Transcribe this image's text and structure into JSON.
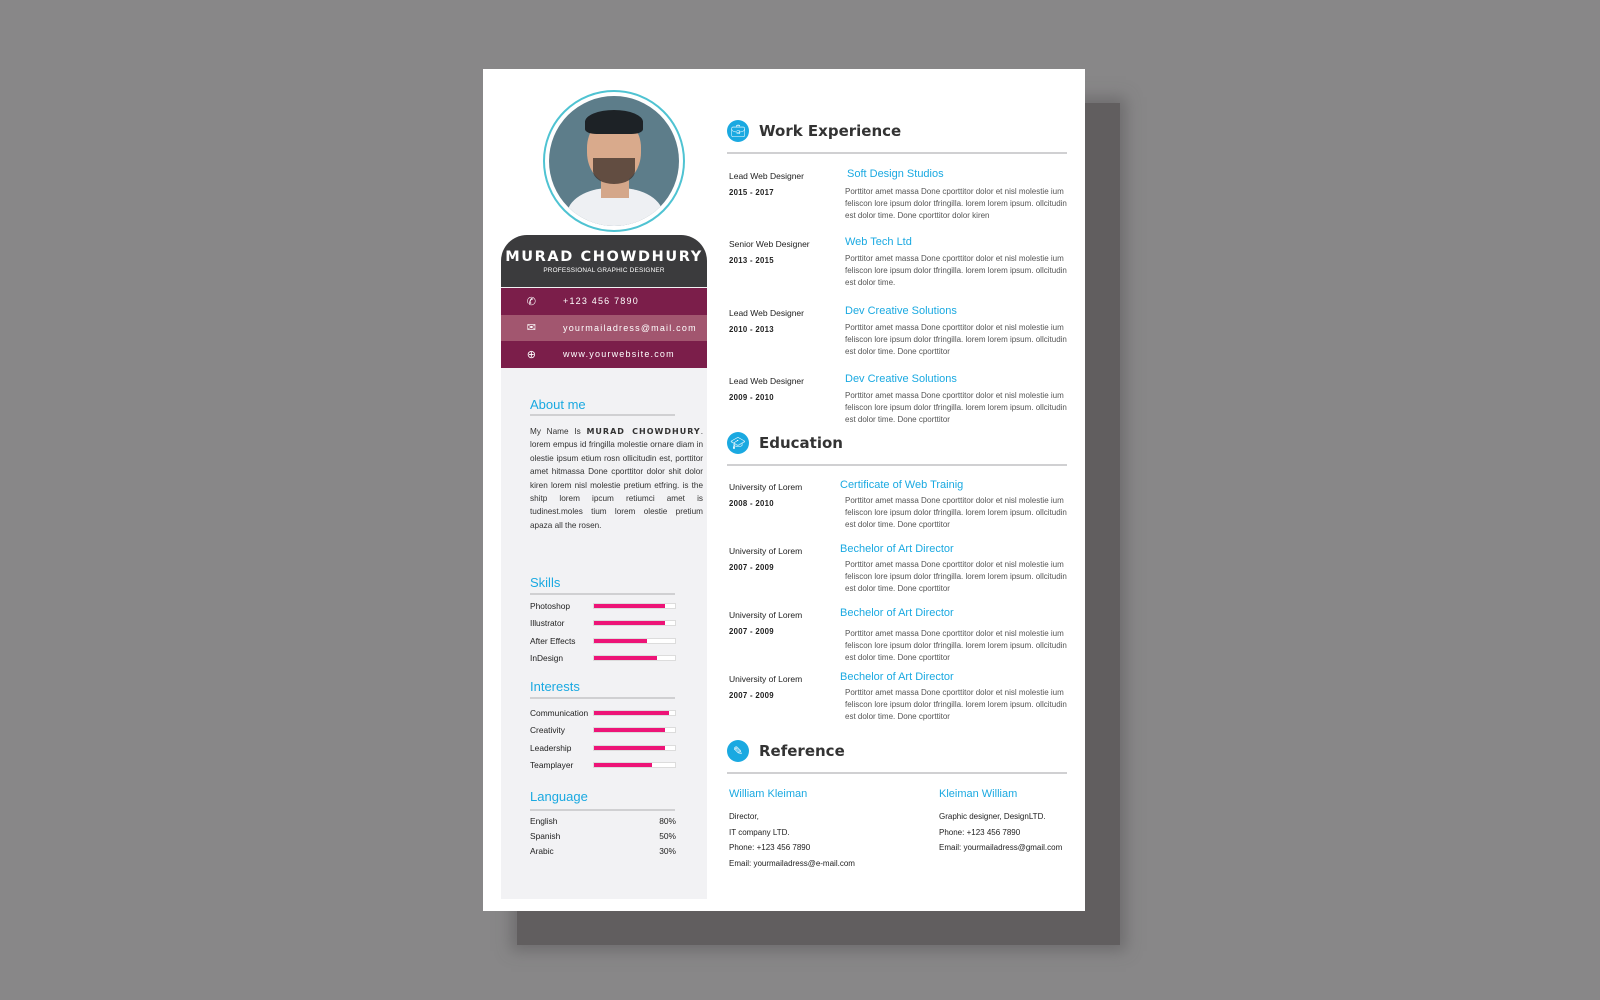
{
  "colors": {
    "accent_blue": "#1aa9e1",
    "magenta_bar": "#ed1477",
    "contact_dark": "#7b1e4a",
    "contact_light": "#a2566f",
    "name_bg": "#3b3b3d"
  },
  "profile": {
    "name": "MURAD CHOWDHURY",
    "title": "PROFESSIONAL GRAPHIC DESIGNER",
    "photo_alt": "profile-photo"
  },
  "contact": [
    {
      "icon": "phone-icon",
      "glyph": "✆",
      "text": "+123 456 7890"
    },
    {
      "icon": "envelope-icon",
      "glyph": "✉",
      "text": "yourmailadress@mail.com"
    },
    {
      "icon": "globe-icon",
      "glyph": "⊕",
      "text": "www.yourwebsite.com"
    }
  ],
  "about": {
    "heading": "About me",
    "intro": "My Name Is",
    "name_emph": "MURAD CHOWDHURY",
    "text": ". lorem empus id fringilla molestie ornare diam in olestie ipsum etium rosn ollicitudin est, porttitor amet hitmassa Done cporttitor dolor shit dolor kiren lorem nisl molestie pretium etfring. is the shitp lorem ipcum retiumci amet is tudinest.moles tium lorem olestie pretium apaza all the rosen."
  },
  "skills": {
    "heading": "Skills",
    "items": [
      {
        "label": "Photoshop",
        "level": 0.88
      },
      {
        "label": "Illustrator",
        "level": 0.88
      },
      {
        "label": "After Effects",
        "level": 0.65
      },
      {
        "label": "InDesign",
        "level": 0.78
      }
    ]
  },
  "interests": {
    "heading": "Interests",
    "items": [
      {
        "label": "Communication",
        "level": 0.92
      },
      {
        "label": "Creativity",
        "level": 0.88
      },
      {
        "label": "Leadership",
        "level": 0.88
      },
      {
        "label": "Teamplayer",
        "level": 0.71
      }
    ]
  },
  "language": {
    "heading": "Language",
    "items": [
      {
        "label": "English",
        "value": "80%"
      },
      {
        "label": "Spanish",
        "value": "50%"
      },
      {
        "label": "Arabic",
        "value": "30%"
      }
    ]
  },
  "work": {
    "heading": "Work Experience",
    "icon": "briefcase-icon",
    "entries": [
      {
        "role": "Lead  Web Designer",
        "years": "2015 - 2017",
        "company": "Soft Design Studios",
        "desc": "Porttitor amet massa Done cporttitor dolor et nisl molestie ium feliscon lore  ipsum dolor tfringilla. lorem lorem ipsum. ollcitudin est dolor time. Done cporttitor dolor kiren"
      },
      {
        "role": "Senior Web Designer",
        "years": "2013 - 2015",
        "company": "Web Tech Ltd",
        "desc": "Porttitor amet massa Done cporttitor dolor et nisl molestie ium feliscon lore  ipsum dolor tfringilla. lorem lorem ipsum. ollcitudin est dolor time."
      },
      {
        "role": "Lead Web Designer",
        "years": "2010 - 2013",
        "company": "Dev Creative Solutions",
        "desc": "Porttitor amet massa Done cporttitor dolor et nisl molestie ium feliscon lore  ipsum dolor tfringilla. lorem lorem ipsum. ollcitudin est dolor time. Done cporttitor"
      },
      {
        "role": "Lead Web Designer",
        "years": "2009 - 2010",
        "company": "Dev Creative Solutions",
        "desc": "Porttitor amet massa Done cporttitor dolor et nisl molestie ium feliscon lore  ipsum dolor tfringilla. lorem lorem ipsum. ollcitudin est dolor time. Done cporttitor"
      }
    ]
  },
  "education": {
    "heading": "Education",
    "icon": "graduation-cap-icon",
    "entries": [
      {
        "school": "University of  Lorem",
        "years": "2008 - 2010",
        "degree": "Certificate of Web Trainig",
        "desc": "Porttitor amet massa Done cporttitor dolor et nisl molestie ium feliscon lore  ipsum dolor tfringilla. lorem lorem ipsum. ollcitudin est dolor time. Done cporttitor"
      },
      {
        "school": "University of  Lorem",
        "years": "2007 - 2009",
        "degree": "Bechelor of Art Director",
        "desc": "Porttitor amet massa Done cporttitor dolor et nisl molestie ium feliscon lore  ipsum dolor tfringilla. lorem lorem ipsum. ollcitudin est dolor time. Done cporttitor"
      },
      {
        "school": "University of  Lorem",
        "years": "2007 - 2009",
        "degree": "Bechelor of Art Director",
        "desc": "Porttitor amet massa Done cporttitor dolor et nisl molestie ium feliscon lore  ipsum dolor tfringilla. lorem lorem ipsum. ollcitudin est dolor time. Done cporttitor"
      },
      {
        "school": "University of  Lorem",
        "years": "2007 - 2009",
        "degree": "Bechelor of Art Director",
        "desc": "Porttitor amet massa Done cporttitor dolor et nisl molestie ium feliscon lore  ipsum dolor tfringilla. lorem lorem ipsum. ollcitudin est dolor time. Done cporttitor"
      }
    ]
  },
  "reference": {
    "heading": "Reference",
    "icon": "document-edit-icon",
    "people": [
      {
        "name": "William Kleiman",
        "lines": [
          "Director,",
          "IT company LTD.",
          "Phone: +123 456 7890",
          "Email: yourmailadress@e-mail.com"
        ]
      },
      {
        "name": "Kleiman William",
        "lines": [
          "Graphic designer, DesignLTD.",
          "Phone:  +123 456 7890",
          "Email: yourmailadress@gmail.com"
        ]
      }
    ]
  }
}
